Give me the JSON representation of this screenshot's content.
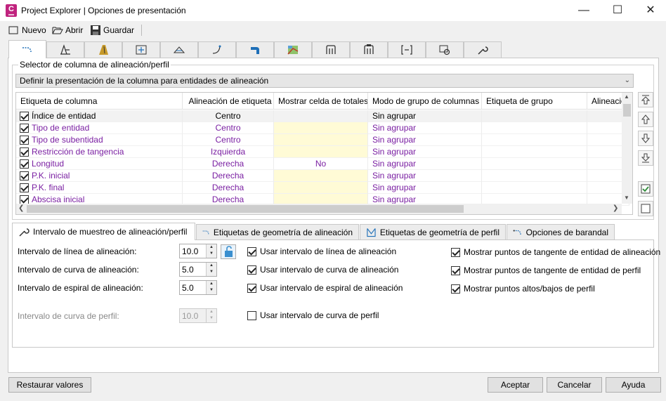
{
  "window": {
    "title": "Project Explorer | Opciones de presentación",
    "app_icon_letter": "C"
  },
  "toolbar": {
    "new_label": "Nuevo",
    "open_label": "Abrir",
    "save_label": "Guardar"
  },
  "top_tabs": [
    {
      "icon": "alignment-entity-icon",
      "active": true
    },
    {
      "icon": "alignment-subentity-icon"
    },
    {
      "icon": "road-icon"
    },
    {
      "icon": "station-marker-icon"
    },
    {
      "icon": "profile-view-icon"
    },
    {
      "icon": "curve-icon"
    },
    {
      "icon": "corridor-icon"
    },
    {
      "icon": "surface-icon"
    },
    {
      "icon": "pipe-network-icon"
    },
    {
      "icon": "pressure-network-icon"
    },
    {
      "icon": "sample-line-icon"
    },
    {
      "icon": "settings-view-icon"
    },
    {
      "icon": "wrench-icon"
    }
  ],
  "selector": {
    "group_label": "Selector de columna de alineación/perfil",
    "dropdown_value": "Definir la presentación de la columna para entidades de alineación"
  },
  "grid": {
    "columns": [
      "Etiqueta de columna",
      "Alineación de etiqueta",
      "Mostrar celda de totales",
      "Modo de grupo de columnas",
      "Etiqueta de grupo",
      "Alineació"
    ],
    "rows": [
      {
        "label": "Índice de entidad",
        "align": "Centro",
        "totals": "",
        "group_mode": "Sin agrupar",
        "group_label": "",
        "checked": true,
        "selected": true
      },
      {
        "label": "Tipo de entidad",
        "align": "Centro",
        "totals": "",
        "group_mode": "Sin agrupar",
        "group_label": "",
        "checked": true
      },
      {
        "label": "Tipo de subentidad",
        "align": "Centro",
        "totals": "",
        "group_mode": "Sin agrupar",
        "group_label": "",
        "checked": true
      },
      {
        "label": "Restricción de tangencia",
        "align": "Izquierda",
        "totals": "",
        "group_mode": "Sin agrupar",
        "group_label": "",
        "checked": true
      },
      {
        "label": "Longitud",
        "align": "Derecha",
        "totals": "No",
        "group_mode": "Sin agrupar",
        "group_label": "",
        "checked": true
      },
      {
        "label": "P.K. inicial",
        "align": "Derecha",
        "totals": "",
        "group_mode": "Sin agrupar",
        "group_label": "",
        "checked": true
      },
      {
        "label": "P.K. final",
        "align": "Derecha",
        "totals": "",
        "group_mode": "Sin agrupar",
        "group_label": "",
        "checked": true
      },
      {
        "label": "Abscisa inicial",
        "align": "Derecha",
        "totals": "",
        "group_mode": "Sin agrupar",
        "group_label": "",
        "checked": true
      }
    ]
  },
  "side_buttons": [
    "move-top-icon",
    "move-up-icon",
    "move-down-icon",
    "move-bottom-icon",
    "check-all-icon",
    "uncheck-all-icon"
  ],
  "sub_tabs": [
    {
      "label": "Intervalo de muestreo de alineación/perfil",
      "icon": "wrench-icon",
      "active": true
    },
    {
      "label": "Etiquetas de geometría de alineación",
      "icon": "alignment-label-icon"
    },
    {
      "label": "Etiquetas de geometría de perfil",
      "icon": "profile-label-icon"
    },
    {
      "label": "Opciones de barandal",
      "icon": "railing-icon"
    }
  ],
  "intervals": {
    "alignment_line": {
      "label": "Intervalo de línea de alineación:",
      "value": "10.0"
    },
    "alignment_curve": {
      "label": "Intervalo de curva de alineación:",
      "value": "5.0"
    },
    "alignment_spiral": {
      "label": "Intervalo de espiral de alineación:",
      "value": "5.0"
    },
    "profile_curve": {
      "label": "Intervalo de curva de perfil:",
      "value": "10.0"
    }
  },
  "use_checks": [
    {
      "label": "Usar intervalo de línea de alineación",
      "checked": true
    },
    {
      "label": "Usar intervalo de curva de alineación",
      "checked": true
    },
    {
      "label": "Usar intervalo de espiral de alineación",
      "checked": true
    },
    {
      "label": "Usar intervalo de curva de perfil",
      "checked": false
    }
  ],
  "show_checks": [
    {
      "label": "Mostrar puntos de tangente de entidad de alineación",
      "checked": true
    },
    {
      "label": "Mostrar puntos de tangente de entidad de perfil",
      "checked": true
    },
    {
      "label": "Mostrar puntos altos/bajos de perfil",
      "checked": true
    }
  ],
  "footer": {
    "reset_label": "Restaurar valores",
    "ok_label": "Aceptar",
    "cancel_label": "Cancelar",
    "help_label": "Ayuda"
  },
  "colors": {
    "accent_purple": "#7a1fa2",
    "totals_yellow": "#fffbd6",
    "app_icon": "#c0237e"
  }
}
